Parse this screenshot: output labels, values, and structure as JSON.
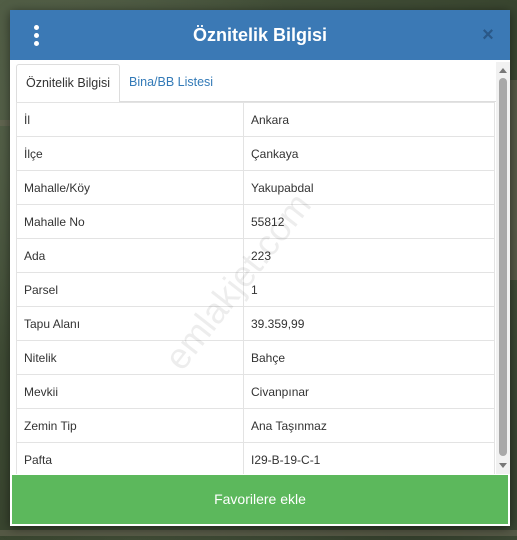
{
  "dialog": {
    "title": "Öznitelik Bilgisi",
    "close_symbol": "×",
    "menu_icon": "kebab-menu-icon"
  },
  "tabs": [
    {
      "label": "Öznitelik Bilgisi",
      "active": true
    },
    {
      "label": "Bina/BB Listesi",
      "active": false
    }
  ],
  "attributes": [
    {
      "key": "İl",
      "value": "Ankara"
    },
    {
      "key": "İlçe",
      "value": "Çankaya"
    },
    {
      "key": "Mahalle/Köy",
      "value": "Yakupabdal"
    },
    {
      "key": "Mahalle No",
      "value": "55812"
    },
    {
      "key": "Ada",
      "value": "223"
    },
    {
      "key": "Parsel",
      "value": "1"
    },
    {
      "key": "Tapu Alanı",
      "value": "39.359,99"
    },
    {
      "key": "Nitelik",
      "value": "Bahçe"
    },
    {
      "key": "Mevkii",
      "value": "Civanpınar"
    },
    {
      "key": "Zemin Tip",
      "value": "Ana Taşınmaz"
    },
    {
      "key": "Pafta",
      "value": "I29-B-19-C-1"
    }
  ],
  "watermark": "emlakjet.com",
  "footer": {
    "button_label": "Favorilere ekle"
  },
  "colors": {
    "header": "#3b79b5",
    "tab_link": "#337ab7",
    "button": "#5cb85c"
  }
}
